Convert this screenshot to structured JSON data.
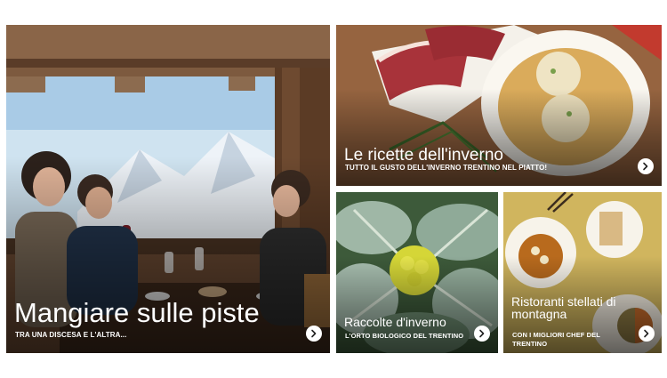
{
  "cards": [
    {
      "title": "Mangiare sulle piste",
      "subtitle": "TRA UNA DISCESA E L'ALTRA...",
      "icon": "arrow-right-icon"
    },
    {
      "title": "Le ricette dell'inverno",
      "subtitle": "TUTTO IL GUSTO DELL'INVERNO TRENTINO NEL PIATTO!",
      "icon": "arrow-right-icon"
    },
    {
      "title": "Raccolte d'inverno",
      "subtitle": "L'ORTO BIOLOGICO DEL TRENTINO",
      "icon": "arrow-right-icon"
    },
    {
      "title": "Ristoranti stellati di montagna",
      "subtitle": "CON I MIGLIORI CHEF DEL TRENTINO",
      "icon": "arrow-right-icon"
    }
  ]
}
